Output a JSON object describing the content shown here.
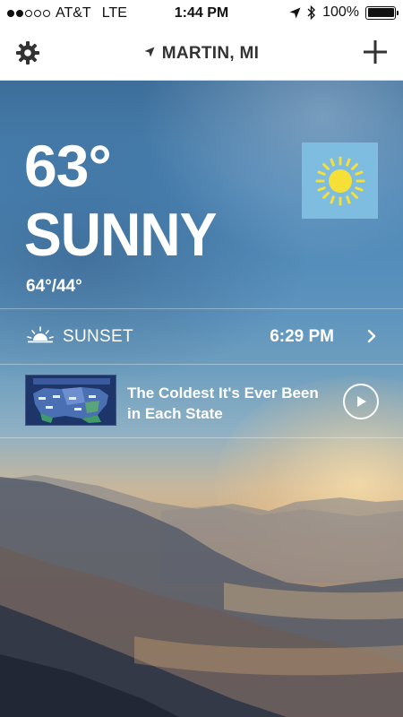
{
  "status_bar": {
    "carrier": "AT&T",
    "network": "LTE",
    "time": "1:44 PM",
    "battery": "100%",
    "battery_level": 1.0,
    "signal_bars_filled": 2,
    "signal_bars_total": 5
  },
  "header": {
    "location": "MARTIN, MI"
  },
  "current": {
    "temperature": "63°",
    "condition": "SUNNY",
    "high_low": "64°/44°",
    "icon": "sun-icon"
  },
  "sunset": {
    "label": "SUNSET",
    "time": "6:29 PM"
  },
  "video": {
    "title": "The Coldest It's Ever Been in Each State"
  },
  "colors": {
    "icon_box": "#7fbde0",
    "sun": "#f6e037",
    "text": "#ffffff"
  }
}
